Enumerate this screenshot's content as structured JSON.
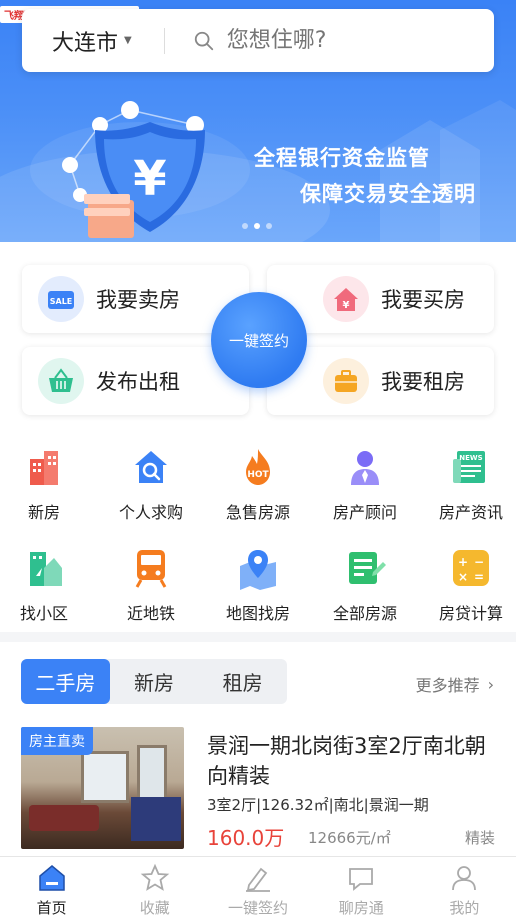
{
  "watermark": "飞翔下载 www.FXXZ.com",
  "search": {
    "city": "大连市",
    "placeholder": "您想住哪?"
  },
  "banner": {
    "slogan_line1": "全程银行资金监管",
    "slogan_line2": "保障交易安全透明",
    "slide_count": 3,
    "active_slide": 2
  },
  "actions": {
    "sell": "我要卖房",
    "buy": "我要买房",
    "rent_out": "发布出租",
    "rent": "我要租房",
    "sign": "一键签约",
    "sell_badge": "SALE"
  },
  "grid": [
    {
      "label": "新房",
      "icon": "building-icon",
      "color": "#ef5b4c"
    },
    {
      "label": "个人求购",
      "icon": "house-search-icon",
      "color": "#3b82f6"
    },
    {
      "label": "急售房源",
      "icon": "hot-fire-icon",
      "color": "#f57c1f"
    },
    {
      "label": "房产顾问",
      "icon": "consultant-icon",
      "color": "#7b6cf6"
    },
    {
      "label": "房产资讯",
      "icon": "news-icon",
      "color": "#2fbf8f"
    },
    {
      "label": "找小区",
      "icon": "community-icon",
      "color": "#2fbf8f"
    },
    {
      "label": "近地铁",
      "icon": "subway-icon",
      "color": "#f57c1f"
    },
    {
      "label": "地图找房",
      "icon": "map-pin-icon",
      "color": "#3b82f6"
    },
    {
      "label": "全部房源",
      "icon": "list-edit-icon",
      "color": "#2fbf6f"
    },
    {
      "label": "房贷计算",
      "icon": "calculator-icon",
      "color": "#f5b82e"
    }
  ],
  "tabs": {
    "items": [
      "二手房",
      "新房",
      "租房"
    ],
    "active": 0,
    "more": "更多推荐"
  },
  "listing": {
    "badge": "房主直卖",
    "title": "景润一期北岗街3室2厅南北朝向精装",
    "meta": "3室2厅|126.32㎡|南北|景润一期",
    "price": "160.0万",
    "unit_price": "12666元/㎡",
    "tag": "精装"
  },
  "nav": {
    "items": [
      "首页",
      "收藏",
      "一键签约",
      "聊房通",
      "我的"
    ],
    "active": 0
  },
  "colors": {
    "accent": "#3b82f6",
    "price": "#e8433a"
  }
}
